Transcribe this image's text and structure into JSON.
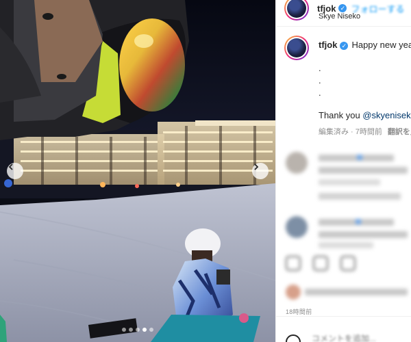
{
  "post": {
    "username": "tfjok",
    "verified_mark": "✓",
    "follow_text": "フォローする",
    "location": "Skye Niseko",
    "caption_username": "tfjok",
    "caption_text": "Happy new year",
    "caption_dots": [
      ".",
      ".",
      "."
    ],
    "thanks_prefix": "Thank you",
    "thanks_mention": "@skyeniseko",
    "meta_edited": "編集済み · 7時間前",
    "meta_translate": "翻訳を見る",
    "time_ago": "18時間前",
    "comment_placeholder": "コメントを追加..."
  },
  "carousel": {
    "dot_count": 5,
    "active_dot": 3
  },
  "icons": {
    "prev": "chevron-left-icon",
    "next": "chevron-right-icon",
    "verified": "verified-badge-icon",
    "emoji": "emoji-icon"
  },
  "colors": {
    "link_blue": "#0095f6",
    "mention_blue": "#00376b",
    "verified_blue": "#3897f0",
    "text_dark": "#262626",
    "text_muted": "#8e8e8e"
  }
}
